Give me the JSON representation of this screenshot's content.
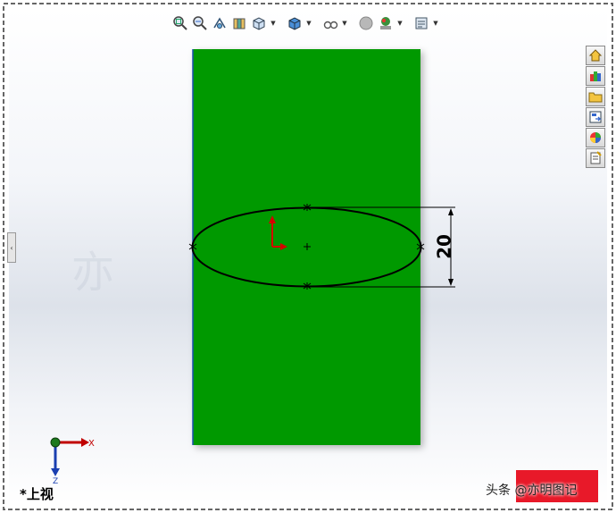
{
  "view": {
    "label": "*上视",
    "triad": {
      "x_label": "X",
      "z_label": "Z"
    }
  },
  "toolbar": {
    "items": [
      {
        "icon": "zoom-to-fit-icon",
        "dropdown": false
      },
      {
        "icon": "zoom-to-area-icon",
        "dropdown": false
      },
      {
        "icon": "previous-view-icon",
        "dropdown": false
      },
      {
        "icon": "section-view-icon",
        "dropdown": false
      },
      {
        "icon": "view-orientation-icon",
        "dropdown": true
      },
      {
        "icon": "display-style-icon",
        "dropdown": true
      },
      {
        "icon": "hide-show-items-icon",
        "dropdown": true
      },
      {
        "icon": "edit-appearance-icon",
        "dropdown": false
      },
      {
        "icon": "apply-scene-icon",
        "dropdown": true
      },
      {
        "icon": "view-settings-icon",
        "dropdown": true
      }
    ]
  },
  "task_pane": {
    "items": [
      {
        "icon": "home-icon"
      },
      {
        "icon": "design-library-icon"
      },
      {
        "icon": "file-explorer-icon"
      },
      {
        "icon": "view-palette-icon"
      },
      {
        "icon": "appearances-icon"
      },
      {
        "icon": "custom-properties-icon"
      }
    ]
  },
  "sketch": {
    "dimension_value": "20",
    "colors": {
      "face": "#009900",
      "sketch_line": "#000000",
      "origin": "#d40000"
    }
  },
  "watermark": {
    "logo_text": "头条 @亦明图记"
  }
}
